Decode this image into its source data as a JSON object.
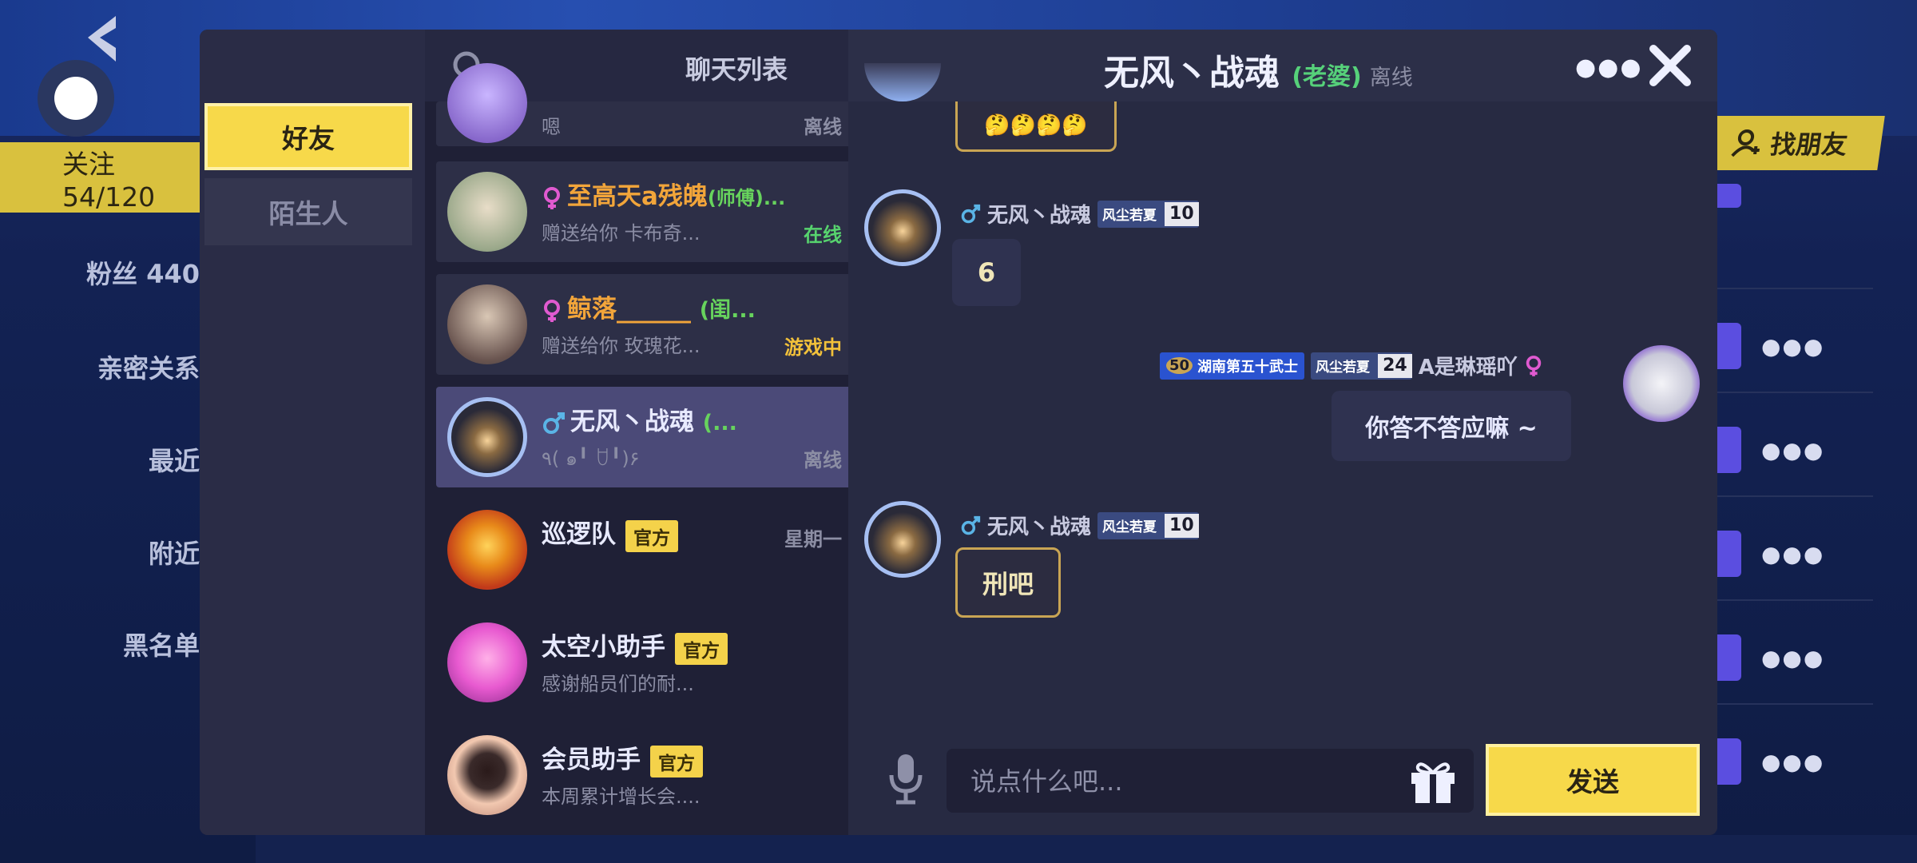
{
  "background": {
    "follow_chip": "关注 54/120",
    "menu": [
      "粉丝 440",
      "亲密关系",
      "最近",
      "附近",
      "黑名单"
    ],
    "find_friend": "找朋友"
  },
  "tabs": [
    {
      "label": "好友",
      "active": true
    },
    {
      "label": "陌生人",
      "active": false
    }
  ],
  "list": {
    "title": "聊天列表",
    "items": [
      {
        "name": "",
        "preview": "嗯",
        "status": "离线",
        "status_color": "#8c8ea4"
      },
      {
        "name": "至高天a残魄",
        "suffix": "(师傅)...",
        "preview": "赠送给你 卡布奇...",
        "status": "在线",
        "status_color": "#57d36e",
        "name_color": "#f2a53a"
      },
      {
        "name": "鲸落______",
        "suffix": "(闺...",
        "preview": "赠送给你 玫瑰花...",
        "status": "游戏中",
        "status_color": "#f2c13a",
        "name_color": "#f2a53a"
      },
      {
        "name": "无风丶战魂",
        "suffix": "(...",
        "preview": "٩( ๑╹ ꇴ╹)۶",
        "status": "离线",
        "status_color": "#8c8ea4",
        "name_color": "#e8eaff"
      },
      {
        "name": "巡逻队",
        "tag": "官方",
        "preview": "",
        "status": "星期一",
        "status_color": "#8c8ea4"
      },
      {
        "name": "太空小助手",
        "tag": "官方",
        "preview": "感谢船员们的耐...",
        "status": ""
      },
      {
        "name": "会员助手",
        "tag": "官方",
        "preview": "本周累计增长会....",
        "status": ""
      }
    ]
  },
  "chat": {
    "title": "无风丶战魂",
    "relation": "(老婆)",
    "status": "离线",
    "messages": [
      {
        "side": "left",
        "text": "🤔🤔🤔🤔",
        "partial": true
      },
      {
        "side": "left",
        "sender": "无风丶战魂",
        "badge": "风尘若夏",
        "level": "10",
        "text": "6"
      },
      {
        "side": "right",
        "sender": "A是琳瑶吖",
        "title_badge": "湖南第五十武士",
        "title_level": "50",
        "badge": "风尘若夏",
        "level": "24",
        "text": "你答不答应嘛 ~"
      },
      {
        "side": "left",
        "sender": "无风丶战魂",
        "badge": "风尘若夏",
        "level": "10",
        "text": "刑吧"
      }
    ],
    "input_placeholder": "说点什么吧...",
    "send_label": "发送"
  },
  "colors": {
    "accent": "#f7d94a",
    "dialog": "#272a42",
    "online": "#57d36e",
    "official_tag": "#f4d24a"
  }
}
